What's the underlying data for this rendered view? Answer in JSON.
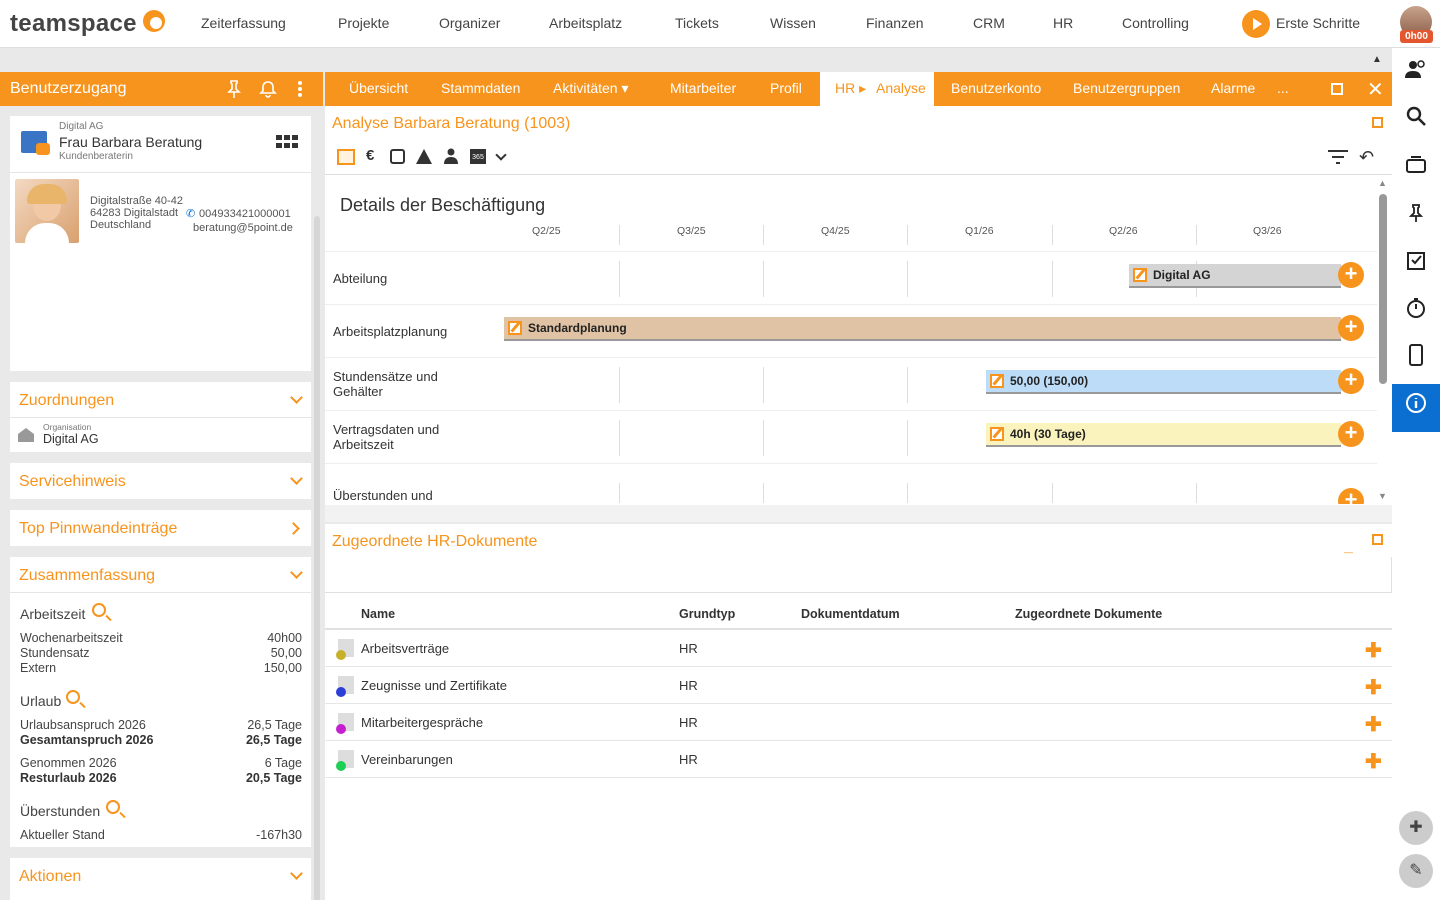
{
  "app": {
    "logo": "teamspace",
    "nav": [
      "Zeiterfassung",
      "Projekte",
      "Organizer",
      "Arbeitsplatz",
      "Tickets",
      "Wissen",
      "Finanzen",
      "CRM",
      "HR",
      "Controlling"
    ],
    "start_label": "Erste Schritte",
    "user_badge": "0h00"
  },
  "left": {
    "title": "Benutzerzugang",
    "contact": {
      "company": "Digital AG",
      "name": "Frau Barbara Beratung",
      "role": "Kundenberaterin",
      "street": "Digitalstraße 40-42",
      "city": "64283 Digitalstadt",
      "country": "Deutschland",
      "phone": "004933421000001",
      "email": "beratung@5point.de"
    },
    "zuordnungen": {
      "title": "Zuordnungen",
      "org_label": "Organisation",
      "org_value": "Digital AG"
    },
    "servicehinweis": "Servicehinweis",
    "pinnwand": "Top Pinnwandeinträge",
    "zusammenfassung": {
      "title": "Zusammenfassung",
      "arbeitszeit": "Arbeitszeit",
      "wochenarbeitszeit_label": "Wochenarbeitszeit",
      "wochenarbeitszeit_value": "40h00",
      "stundensatz_label": "Stundensatz",
      "stundensatz_value": "50,00",
      "extern_label": "Extern",
      "extern_value": "150,00",
      "urlaub": "Urlaub",
      "urlaubsanspruch_label": "Urlaubsanspruch 2026",
      "urlaubsanspruch_value": "26,5 Tage",
      "gesamtanspruch_label": "Gesamtanspruch 2026",
      "gesamtanspruch_value": "26,5 Tage",
      "genommen_label": "Genommen 2026",
      "genommen_value": "6 Tage",
      "resturlaub_label": "Resturlaub 2026",
      "resturlaub_value": "20,5 Tage",
      "ueberstunden": "Überstunden",
      "aktueller_label": "Aktueller Stand",
      "aktueller_value": "-167h30"
    },
    "aktionen": "Aktionen"
  },
  "tabs": [
    "Übersicht",
    "Stammdaten",
    "Aktivitäten ▾",
    "Mitarbeiter",
    "Profil"
  ],
  "tab_active_parent": "HR ▸",
  "tab_active": "Analyse",
  "tabs_after": [
    "Benutzerkonto",
    "Benutzergruppen",
    "Alarme",
    "..."
  ],
  "analyse": {
    "title": "Analyse Barbara Beratung (1003)",
    "gantt_title": "Details der Beschäftigung",
    "quarters": [
      "Q2/25",
      "Q3/25",
      "Q4/25",
      "Q1/26",
      "Q2/26",
      "Q3/26"
    ],
    "rows": [
      {
        "label": "Abteilung",
        "bar": "Digital AG",
        "color": "#d4d4d4"
      },
      {
        "label": "Arbeitsplatzplanung",
        "bar": "Standardplanung",
        "color": "#e0c3a4"
      },
      {
        "label": "Stundensätze und Gehälter",
        "bar": "50,00 (150,00)",
        "color": "#bcdcf7"
      },
      {
        "label": "Vertragsdaten und Arbeitszeit",
        "bar": "40h (30 Tage)",
        "color": "#fbf3bd"
      },
      {
        "label": "Überstunden und",
        "bar": "",
        "color": ""
      }
    ]
  },
  "documents": {
    "title": "Zugeordnete HR-Dokumente",
    "columns": [
      "Name",
      "Grundtyp",
      "Dokumentdatum",
      "Zugeordnete Dokumente"
    ],
    "rows": [
      {
        "name": "Arbeitsverträge",
        "type": "HR",
        "dot": "#c8b02a"
      },
      {
        "name": "Zeugnisse und Zertifikate",
        "type": "HR",
        "dot": "#2b3fd6"
      },
      {
        "name": "Mitarbeitergespräche",
        "type": "HR",
        "dot": "#c61fcf"
      },
      {
        "name": "Vereinbarungen",
        "type": "HR",
        "dot": "#1fcf55"
      }
    ]
  },
  "colors": {
    "accent": "#f7941d",
    "rail_active": "#0a6fd0"
  }
}
